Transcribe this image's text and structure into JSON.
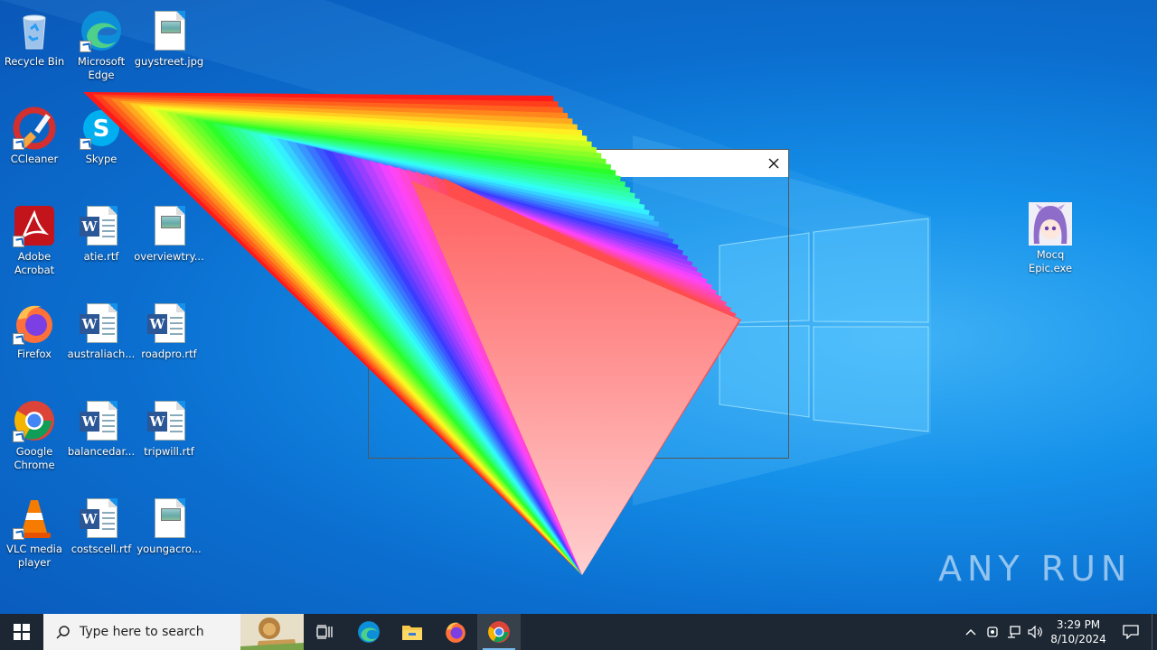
{
  "desktop": {
    "icons": [
      {
        "label": "Recycle Bin"
      },
      {
        "label": "Microsoft Edge"
      },
      {
        "label": "guystreet.jpg"
      },
      {
        "label": "CCleaner"
      },
      {
        "label": "Skype"
      },
      {
        "label": "Adobe Acrobat"
      },
      {
        "label": "atie.rtf"
      },
      {
        "label": "overviewtry..."
      },
      {
        "label": "Firefox"
      },
      {
        "label": "australiach..."
      },
      {
        "label": "roadpro.rtf"
      },
      {
        "label": "Google Chrome"
      },
      {
        "label": "balancedar..."
      },
      {
        "label": "tripwill.rtf"
      },
      {
        "label": "VLC media player"
      },
      {
        "label": "costscell.rtf"
      },
      {
        "label": "youngacro..."
      },
      {
        "label": "Mocq Epic.exe"
      }
    ]
  },
  "dialog": {
    "title": ""
  },
  "watermark": {
    "text": "ANY RUN"
  },
  "taskbar": {
    "search_placeholder": "Type here to search",
    "pinned": [
      "task-view",
      "microsoft-edge",
      "file-explorer",
      "firefox",
      "google-chrome"
    ],
    "active_app": "google-chrome"
  },
  "tray": {
    "time": "3:29 PM",
    "date": "8/10/2024"
  },
  "colors": {
    "taskbar": "#1c2733",
    "accent": "#76b9ed",
    "desktop": "#0b6fd0"
  }
}
